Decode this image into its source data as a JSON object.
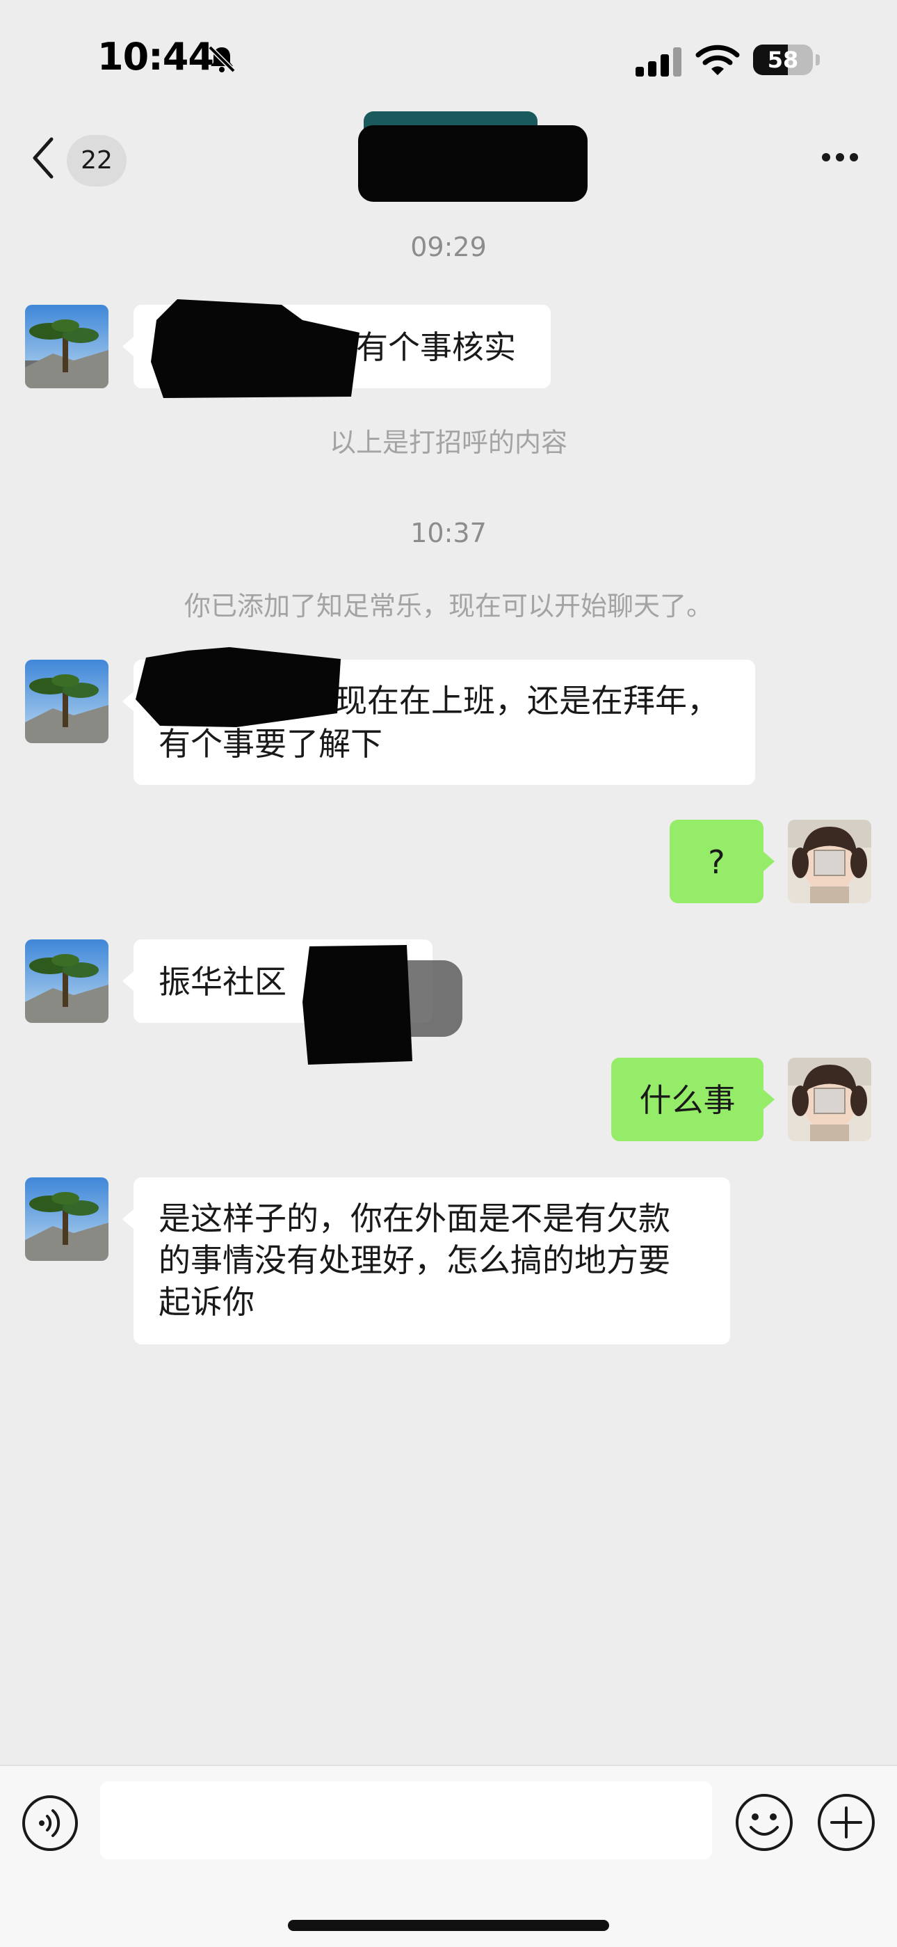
{
  "status_bar": {
    "time": "10:44",
    "battery_level": "58",
    "icons": [
      "bell-slash-icon",
      "signal-icon",
      "wifi-icon",
      "battery-icon"
    ]
  },
  "nav": {
    "back_icon": "chevron-left-icon",
    "unread_count": "22",
    "more_icon": "more-dots-icon"
  },
  "messages": {
    "ts1": "09:29",
    "m1_text": "有个事核实",
    "note1": "以上是打招呼的内容",
    "ts2": "10:37",
    "note2": "你已添加了知足常乐，现在可以开始聊天了。",
    "m2_line1": "现在在上班，还是在拜年，",
    "m2_line2": "有个事要了解下",
    "m3_text": "?",
    "m4_text": "振华社区",
    "m5_text": "什么事",
    "m6_line1": "是这样子的，你在外面是不是有欠款",
    "m6_line2": "的事情没有处理好，怎么搞的地方要",
    "m6_line3": "起诉你"
  },
  "input_bar": {
    "text_value": "",
    "icons": [
      "voice-icon",
      "emoji-icon",
      "plus-icon"
    ]
  },
  "colors": {
    "background": "#ededed",
    "incoming_bubble": "#ffffff",
    "outgoing_bubble": "#95ec69",
    "timestamp": "#8c8c8c"
  }
}
